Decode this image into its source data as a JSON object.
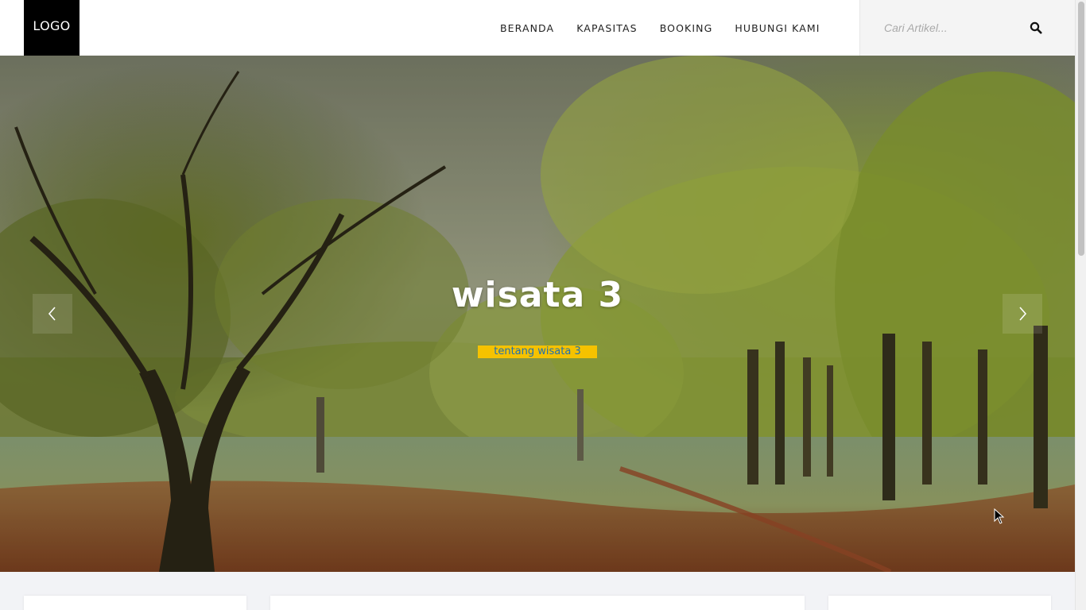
{
  "header": {
    "logo_text": "LOGO",
    "nav": [
      {
        "label": "BERANDA"
      },
      {
        "label": "KAPASITAS"
      },
      {
        "label": "BOOKING"
      },
      {
        "label": "HUBUNGI KAMI"
      }
    ],
    "search": {
      "placeholder": "Cari Artikel...",
      "value": "",
      "icon": "search-icon"
    }
  },
  "slider": {
    "title": "wisata 3",
    "description": "tentang wisata 3",
    "prev_icon": "chevron-left-icon",
    "next_icon": "chevron-right-icon"
  },
  "colors": {
    "logo_bg": "#000000",
    "accent_badge": "#f5c200",
    "badge_text": "#1f6fb2",
    "page_bg": "#f2f3f6"
  }
}
